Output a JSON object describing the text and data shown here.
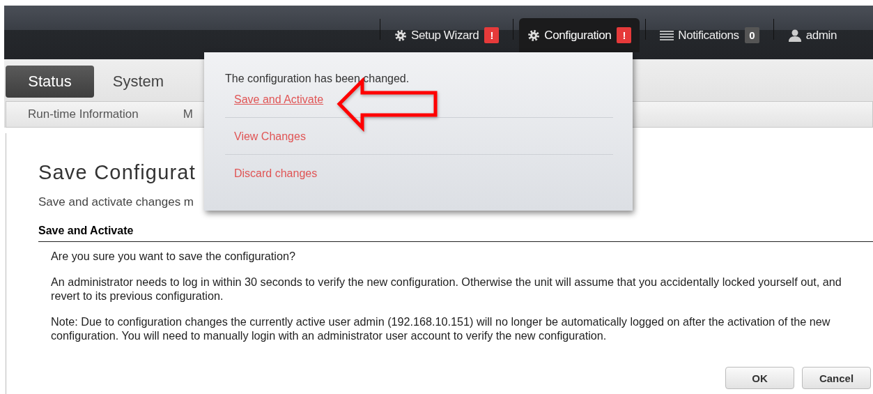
{
  "header": {
    "items": [
      {
        "kind": "gear",
        "label": "Setup Wizard",
        "badge": "!",
        "alert": true,
        "selected": false
      },
      {
        "kind": "gear",
        "label": "Configuration",
        "badge": "!",
        "alert": true,
        "selected": true
      },
      {
        "kind": "list",
        "label": "Notifications",
        "badge": "0",
        "alert": false,
        "selected": false
      },
      {
        "kind": "user",
        "label": "admin",
        "selected": false
      }
    ]
  },
  "tabs": [
    {
      "label": "Status",
      "selected": true
    },
    {
      "label": "System",
      "selected": false
    }
  ],
  "subtabs": [
    {
      "label": "Run-time Information"
    },
    {
      "label": "M"
    }
  ],
  "config_menu": {
    "message": "The configuration has been changed.",
    "links": [
      {
        "label": "Save and Activate",
        "hovered": true
      },
      {
        "label": "View Changes",
        "hovered": false
      },
      {
        "label": "Discard changes",
        "hovered": false
      }
    ]
  },
  "page": {
    "title": "Save Configurat",
    "intro": "Save and activate changes m",
    "section": "Save and Activate",
    "paragraphs": [
      "Are you sure you want to save the configuration?",
      "An administrator needs to log in within 30 seconds to verify the new configuration. Otherwise the unit will assume that you accidentally locked yourself out, and revert to its previous configuration.",
      "Note: Due to configuration changes the currently active user admin (192.168.10.151) will no longer be automatically logged on after the activation of the new configuration. You will need to manually login with an administrator user account to verify the new configuration."
    ],
    "buttons": [
      "OK",
      "Cancel"
    ]
  }
}
